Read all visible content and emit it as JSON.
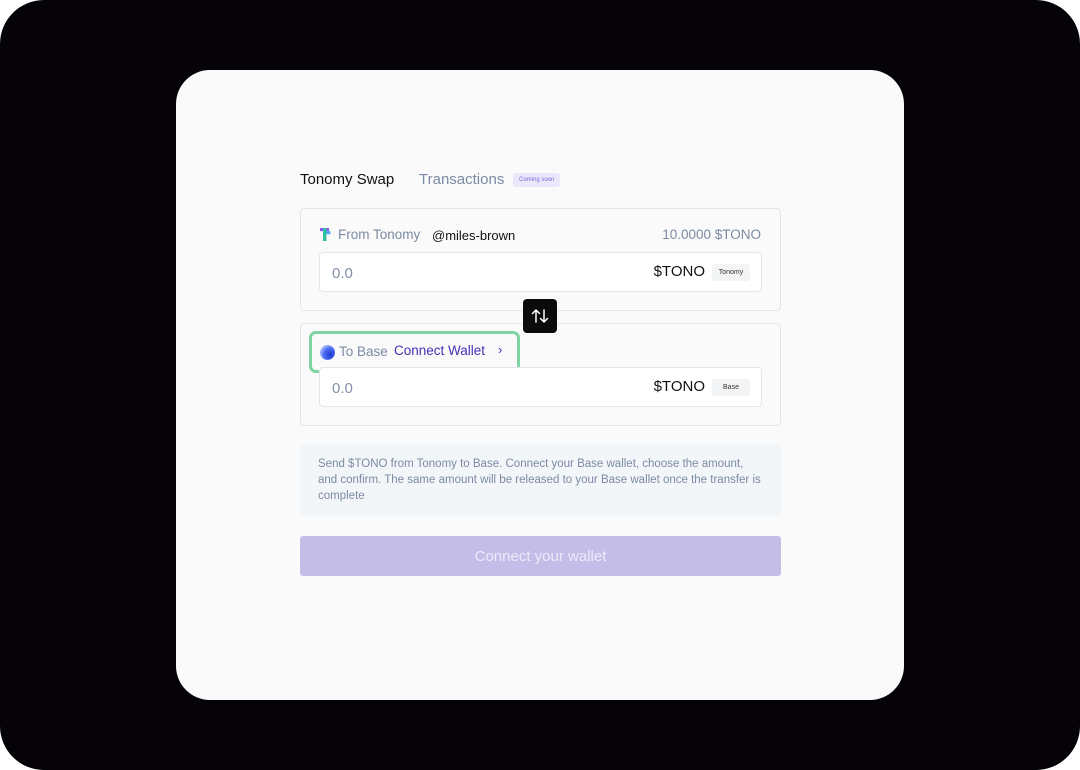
{
  "tabs": {
    "swap": "Tonomy Swap",
    "transactions": "Transactions",
    "coming_soon": "Coming soon"
  },
  "from": {
    "label": "From Tonomy",
    "username": "@miles-brown",
    "balance": "10.0000 $TONO",
    "amount_placeholder": "0.0",
    "token": "$TONO",
    "chain": "Tonomy"
  },
  "to": {
    "label": "To Base",
    "connect_label": "Connect Wallet",
    "amount_placeholder": "0.0",
    "token": "$TONO",
    "chain": "Base"
  },
  "info_text": "Send $TONO from Tonomy to Base. Connect your Base wallet, choose the amount, and confirm. The same amount will be released to your Base wallet once the transfer is complete",
  "cta_label": "Connect your wallet",
  "icons": {
    "swap_direction": "swap-vertical-arrows",
    "tonomy_logo": "tonomy-logo",
    "base_logo": "base-logo",
    "connect_chevron": "chevron-right"
  },
  "colors": {
    "accent_link": "#4a2fb5",
    "cta_background": "#c4bde8",
    "highlight_border": "#7fd4a4",
    "muted_text": "#7c8aa3"
  }
}
